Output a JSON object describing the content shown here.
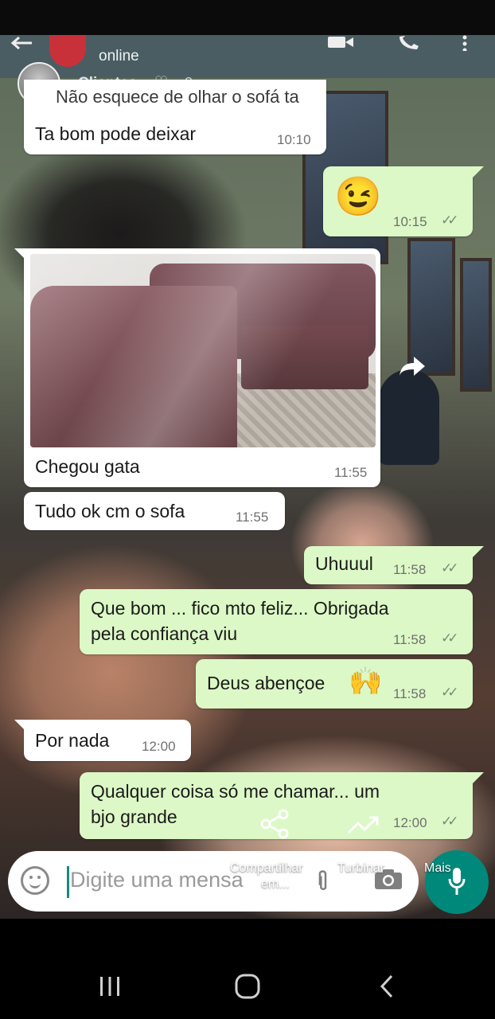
{
  "header": {
    "status": "online",
    "story_name": "Clientes",
    "story_time": "8 sem"
  },
  "messages": [
    {
      "dir": "in",
      "text": "Não esquece de olhar o sofá ta",
      "time": ""
    },
    {
      "dir": "in",
      "text": "Ta bom pode deixar",
      "time": "10:10"
    },
    {
      "dir": "out",
      "text": "",
      "emoji": "😉",
      "time": "10:15"
    },
    {
      "dir": "in",
      "text": "Chegou gata",
      "time": "11:55",
      "has_photo": true
    },
    {
      "dir": "in",
      "text": "Tudo ok cm o sofa",
      "time": "11:55"
    },
    {
      "dir": "out",
      "text": "Uhuuul",
      "time": "11:58"
    },
    {
      "dir": "out",
      "text": "Que bom ... fico mto feliz... Obrigada",
      "text2": "pela confiança viu",
      "time": "11:58"
    },
    {
      "dir": "out",
      "text": "Deus abençoe",
      "emoji": "🙌",
      "time": "11:58"
    },
    {
      "dir": "in",
      "text": "Por nada",
      "time": "12:00"
    },
    {
      "dir": "out",
      "text": "Qualquer coisa só me chamar... um",
      "text2": "bjo grande",
      "time": "12:00"
    }
  ],
  "composer": {
    "placeholder": "Digite uma mensa"
  },
  "story_overlay": {
    "share_label": "Compartilhar",
    "share_label2": "em...",
    "boost_label": "Turbinar",
    "more_label": "Mais"
  },
  "colors": {
    "outgoing_bubble": "#dcf8c6",
    "incoming_bubble": "#ffffff",
    "mic_button": "#00897b"
  },
  "icons": [
    "back-arrow-icon",
    "video-call-icon",
    "phone-icon",
    "more-vert-icon",
    "emoji-icon",
    "attach-icon",
    "camera-icon",
    "mic-icon",
    "share-icon",
    "trending-icon",
    "recent-apps-icon",
    "home-icon",
    "back-nav-icon"
  ]
}
